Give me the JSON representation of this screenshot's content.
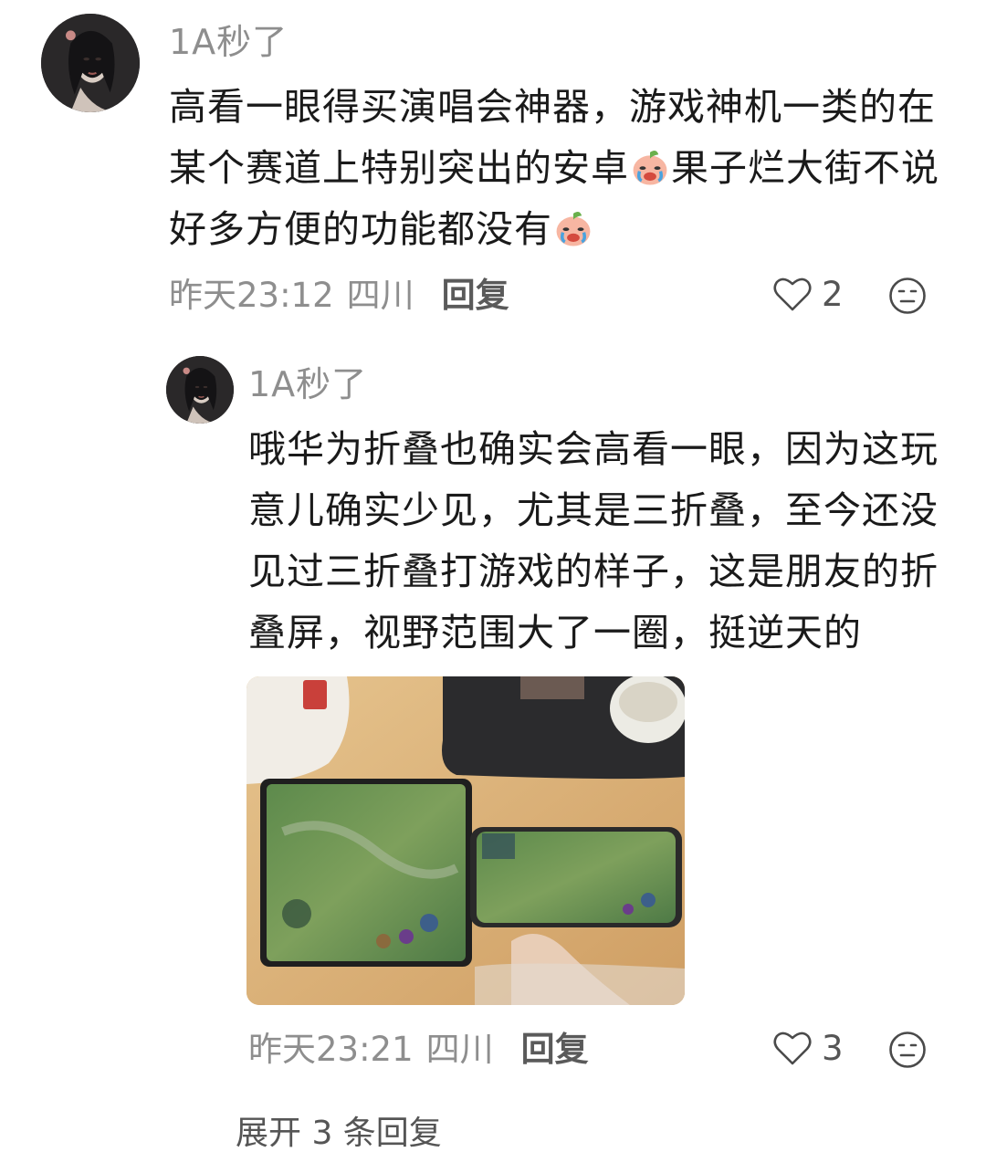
{
  "comments": [
    {
      "username": "1A秒了",
      "text_segments": [
        "高看一眼得买演唱会神器，游戏神机一类的在某个赛道上特别突出的安卓",
        "果子烂大街不说好多方便的功能都没有"
      ],
      "emoji": "crying-peach-emoji",
      "time": "昨天23:12",
      "location": "四川",
      "reply_label": "回复",
      "likes": "2"
    },
    {
      "username": "1A秒了",
      "text": "哦华为折叠也确实会高看一眼，因为这玩意儿确实少见，尤其是三折叠，至今还没见过三折叠打游戏的样子，这是朋友的折叠屏，视野范围大了一圈，挺逆天的",
      "image_alt": "foldable-phone-and-phone-playing-game-photo",
      "time": "昨天23:21",
      "location": "四川",
      "reply_label": "回复",
      "likes": "3"
    }
  ],
  "more_replies": "展开 3 条回复",
  "icons": {
    "like": "heart-outline-icon",
    "react": "neutral-face-icon"
  },
  "colors": {
    "text": "#1a1a1a",
    "secondary": "#8e8e8e",
    "background": "#ffffff"
  }
}
